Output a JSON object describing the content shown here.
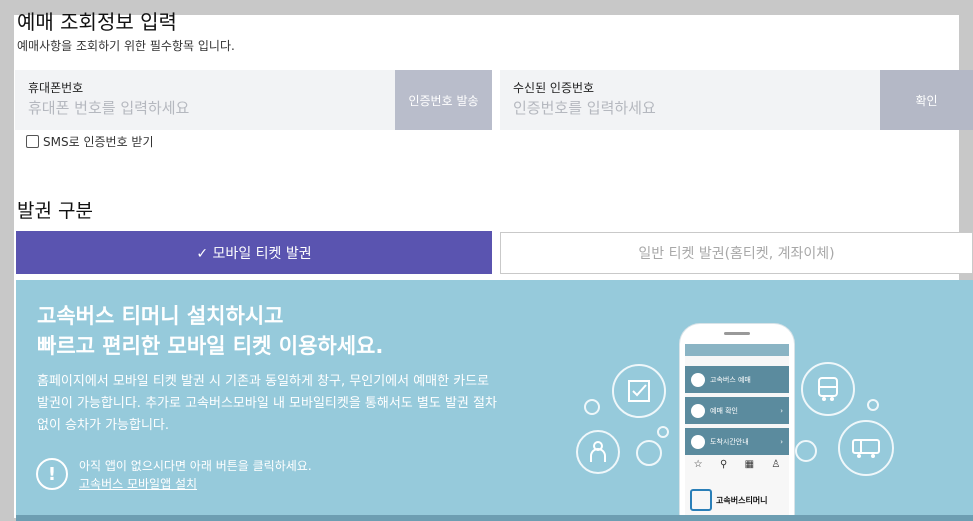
{
  "header": {
    "title": "예매 조회정보 입력",
    "subtitle": "예매사항을 조회하기 위한 필수항목 입니다."
  },
  "phone_field": {
    "label": "휴대폰번호",
    "placeholder": "휴대폰 번호를 입력하세요",
    "value": "",
    "button": "인증번호 발송"
  },
  "code_field": {
    "label": "수신된 인증번호",
    "placeholder": "인증번호를 입력하세요",
    "value": "",
    "button": "확인"
  },
  "sms_option": {
    "label": "SMS로 인증번호 받기",
    "checked": false
  },
  "issue_type": {
    "title": "발권 구분",
    "mobile_label": "✓ 모바일 티켓 발권",
    "general_label": "일반 티켓 발권(홈티켓, 계좌이체)",
    "selected": "mobile",
    "accent_color": "#5a54b0"
  },
  "promo": {
    "headline_line1": "고속버스 티머니 설치하시고",
    "headline_line2": "빠르고 편리한 모바일 티켓 이용하세요.",
    "body_line1": "홈페이지에서 모바일 티켓 발권 시 기존과 동일하게 창구, 무인기에서 예매한 카드로",
    "body_line2": "발권이 가능합니다. 추가로 고속버스모바일 내 모바일티켓을 통해서도 별도 발권 절차",
    "body_line3": "없이 승차가 가능합니다.",
    "notice_icon": "!",
    "notice_text": "아직 앱이 없으시다면 아래 버튼을 클릭하세요.",
    "install_link": "고속버스 모바일앱 설치",
    "background_color": "#96cadb",
    "phone_mockup": {
      "menu": [
        "고속버스 예매",
        "예매 확인",
        "도착시간안내"
      ],
      "app_name": "고속버스티머니"
    },
    "deco_icons": [
      "check-icon",
      "bus-icon",
      "person-icon",
      "bus-side-icon"
    ]
  }
}
